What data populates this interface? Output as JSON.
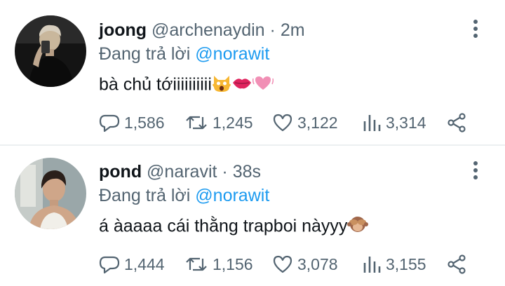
{
  "tweets": [
    {
      "name": "joong",
      "handle": "@archenaydin",
      "separator": "·",
      "time": "2m",
      "reply_prefix": "Đang trả lời",
      "reply_to": "@norawit",
      "text": "bà chủ tớiiiiiiiiii",
      "emojis": [
        "scream-cat-icon",
        "lips-icon",
        "beating-heart-icon"
      ],
      "replies": "1,586",
      "retweets": "1,245",
      "likes": "3,122",
      "views": "3,314"
    },
    {
      "name": "pond",
      "handle": "@naravit",
      "separator": "·",
      "time": "38s",
      "reply_prefix": "Đang trả lời",
      "reply_to": "@norawit",
      "text": "á àaaaa cái thằng trapboi nàyyy",
      "emojis": [
        "see-no-evil-monkey-icon"
      ],
      "replies": "1,444",
      "retweets": "1,156",
      "likes": "3,078",
      "views": "3,155"
    }
  ],
  "colors": {
    "text": "#0f1419",
    "muted": "#536471",
    "mention": "#1d9bf0",
    "divider": "#eceff1"
  }
}
